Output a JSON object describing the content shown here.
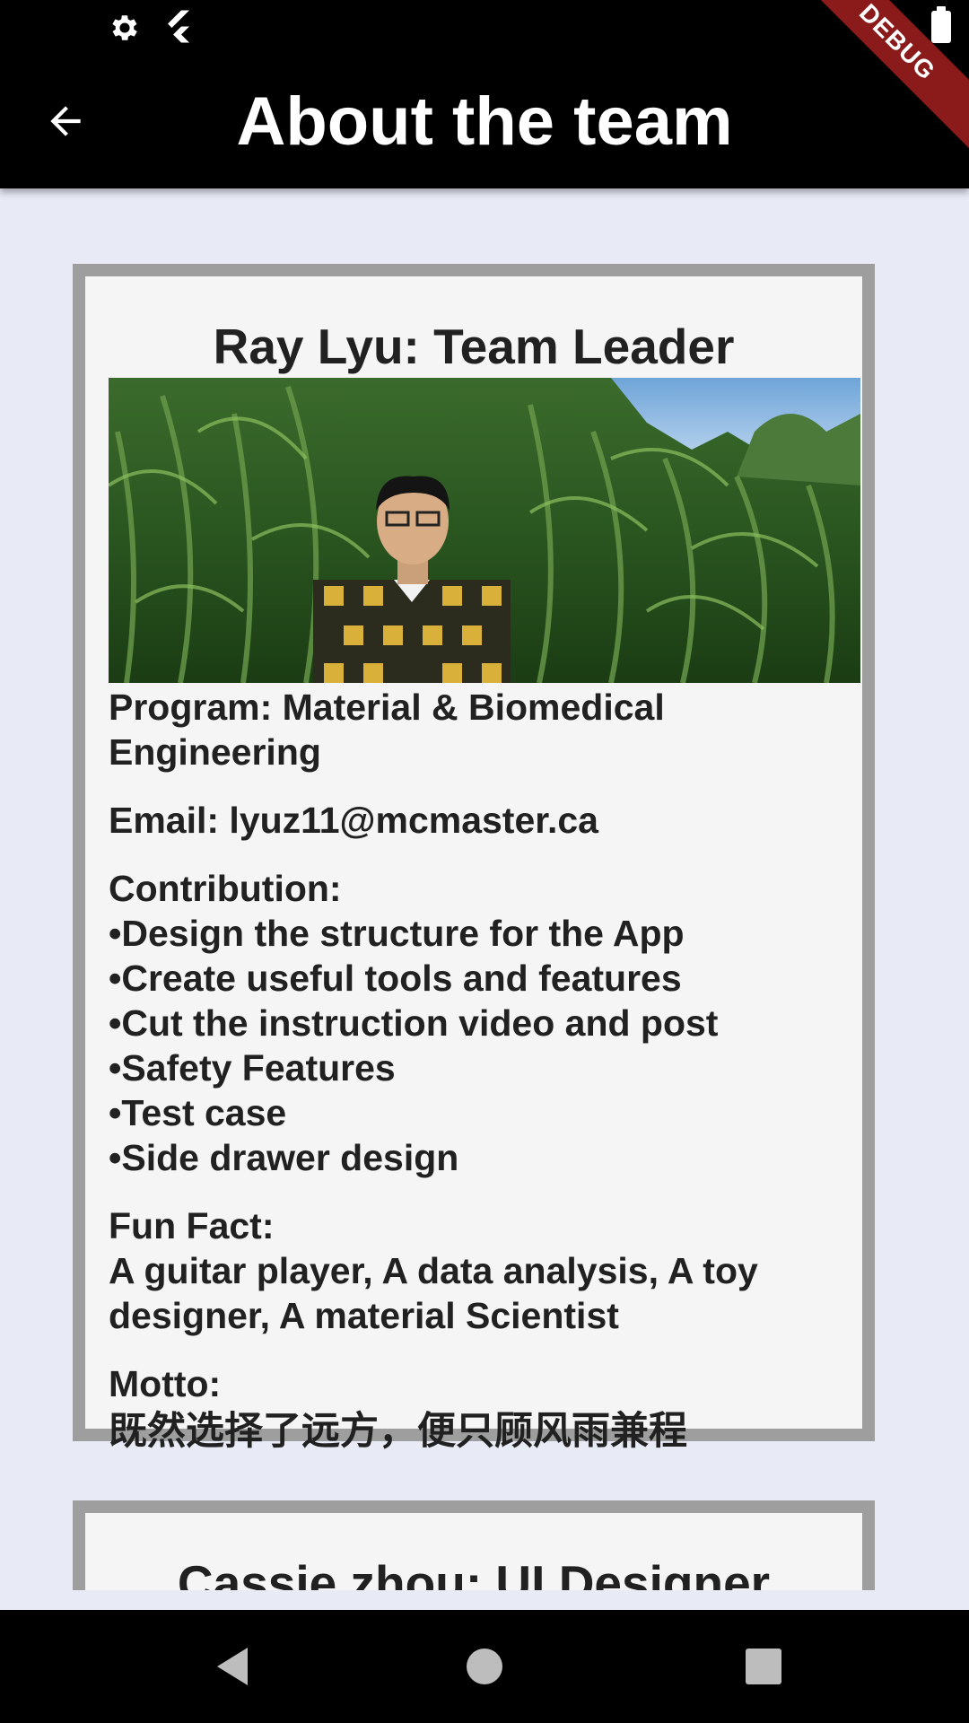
{
  "app_bar": {
    "title": "About the team",
    "debug_banner": "DEBUG"
  },
  "status_bar": {
    "icons": [
      "gear-icon",
      "flutter-icon",
      "battery-icon"
    ]
  },
  "members": [
    {
      "heading": "Ray Lyu: Team Leader",
      "photo_alt": "team-member-photo",
      "program": "Program: Material & Biomedical Engineering",
      "email": "Email: lyuz11@mcmaster.ca",
      "contribution_label": "Contribution:",
      "contributions": [
        "•Design the structure for the App",
        "•Create useful tools and features",
        "•Cut the instruction video and post",
        "•Safety Features",
        "•Test case",
        "•Side drawer design"
      ],
      "fun_fact_label": "Fun Fact:",
      "fun_fact": "A guitar player, A data analysis, A toy designer, A material Scientist",
      "motto_label": "Motto:",
      "motto": "既然选择了远方，便只顾风雨兼程"
    },
    {
      "heading": "Cassie zhou: UI Designer"
    }
  ],
  "nav_bar": {
    "buttons": [
      "back-triangle-icon",
      "home-circle-icon",
      "recent-square-icon"
    ]
  }
}
